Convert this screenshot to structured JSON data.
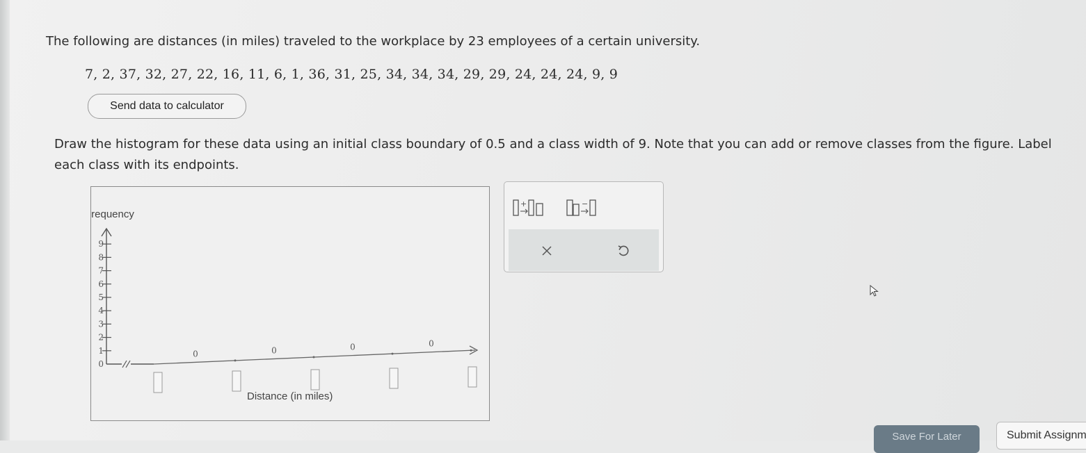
{
  "question": {
    "intro": "The following are distances (in miles) traveled to the workplace by 23 employees of a certain university.",
    "data_values": "7, 2, 37, 32, 27, 22, 16, 11, 6, 1, 36, 31, 25, 34, 34, 34, 29, 29, 24, 24, 24, 9, 9",
    "send_button": "Send data to calculator",
    "instructions": "Draw the histogram for these data using an initial class boundary of 0.5 and a class width of 9. Note that you can add or remove classes from the figure. Label each class with its endpoints."
  },
  "graph": {
    "y_label": "Frequency",
    "x_label": "Distance (in miles)",
    "y_ticks": [
      "0",
      "1",
      "2",
      "3",
      "4",
      "5",
      "6",
      "7",
      "8",
      "9"
    ],
    "bar_values": [
      "0",
      "0",
      "0",
      "0"
    ],
    "endpoint_boxes": 5
  },
  "tools": {
    "add_class_icon": "add-class-icon",
    "remove_class_icon": "remove-class-icon",
    "clear_icon": "close-icon",
    "undo_icon": "undo-icon"
  },
  "footer": {
    "save_later": "Save For Later",
    "submit": "Submit Assignment"
  }
}
